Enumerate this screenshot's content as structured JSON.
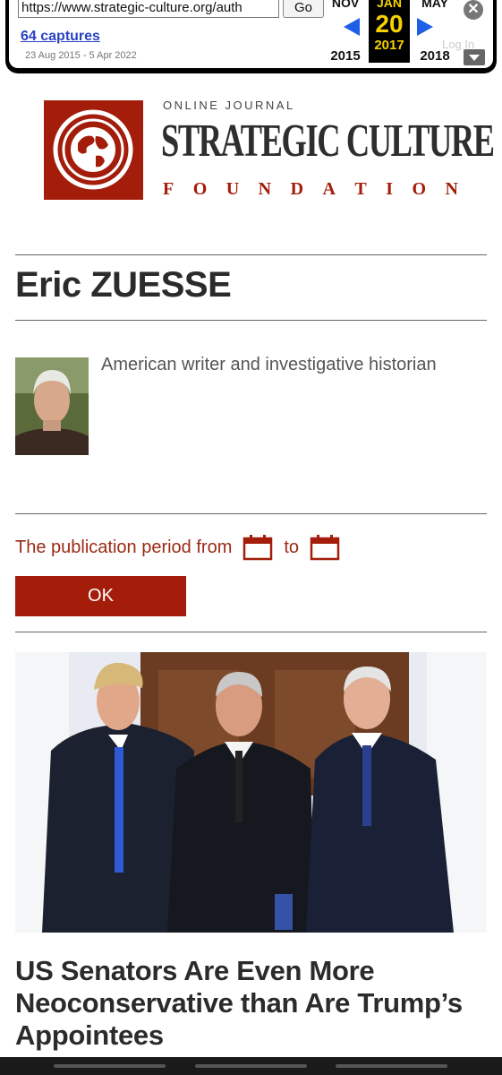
{
  "wayback": {
    "url": "https://www.strategic-culture.org/auth",
    "go_label": "Go",
    "captures": "64 captures",
    "range": "23 Aug 2015 - 5 Apr 2022",
    "prev": {
      "month": "NOV",
      "year": "2015"
    },
    "current": {
      "month": "JAN",
      "day": "20",
      "year": "2017"
    },
    "next": {
      "month": "MAY",
      "year": "2018"
    },
    "login": "Log In",
    "accent_color": "#f5d200",
    "arrow_color": "#1f5fe8"
  },
  "site": {
    "kicker": "ONLINE JOURNAL",
    "title": "STRATEGIC CULTURE",
    "subtitle_letters": [
      "F",
      "O",
      "U",
      "N",
      "D",
      "A",
      "T",
      "I",
      "O",
      "N"
    ],
    "brand_color": "#a31d0a"
  },
  "author": {
    "name": "Eric ZUESSE",
    "bio": "American writer and investigative historian"
  },
  "filter": {
    "from_label": "The publication period from",
    "to_label": "to",
    "ok_label": "OK"
  },
  "article": {
    "title": "US Senators Are Even More Neoconservative than Are Trump’s Appointees"
  }
}
